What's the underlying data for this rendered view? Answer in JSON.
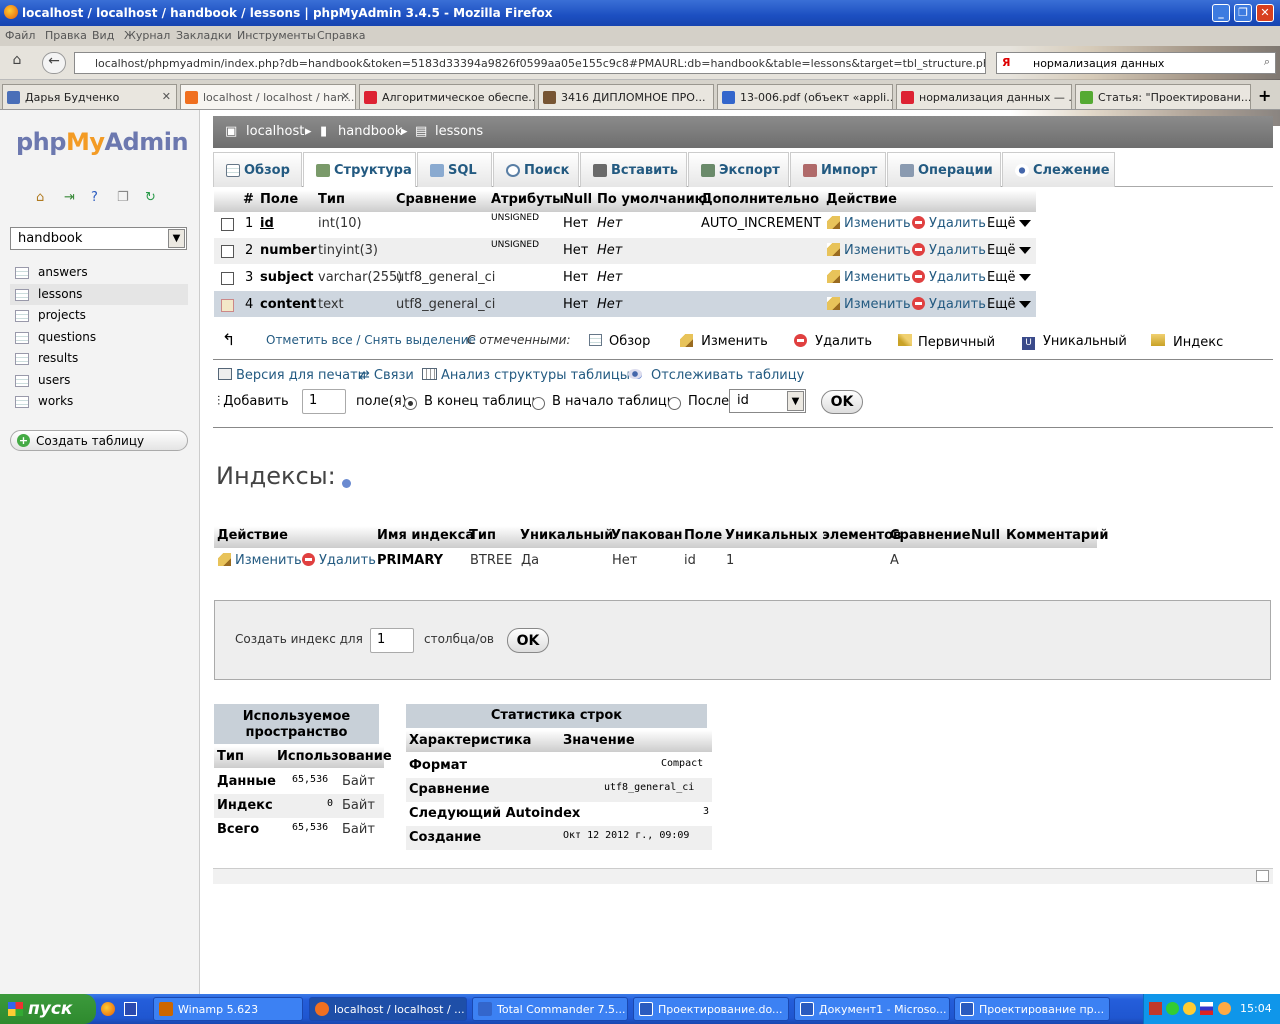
{
  "window": {
    "title": "localhost / localhost / handbook / lessons | phpMyAdmin 3.4.5 - Mozilla Firefox"
  },
  "menubar": [
    "Файл",
    "Правка",
    "Вид",
    "Журнал",
    "Закладки",
    "Инструменты",
    "Справка"
  ],
  "navbar": {
    "url": "localhost/phpmyadmin/index.php?db=handbook&token=5183d33394a9826f0599aa05e155c9c8#PMAURL:db=handbook&table=lessons&target=tbl_structure.php&token=5183",
    "search": "нормализация данных"
  },
  "browser_tabs": [
    {
      "label": "Дарья Будченко",
      "color": "#4a6fb8"
    },
    {
      "label": "localhost / localhost / han...",
      "color": "#f07020",
      "active": true
    },
    {
      "label": "Алгоритмическое обеспе...",
      "color": "#d23"
    },
    {
      "label": "3416 ДИПЛОМНОЕ ПРО...",
      "color": "#753"
    },
    {
      "label": "13-006.pdf (объект «appli...",
      "color": "#36c"
    },
    {
      "label": "нормализация данных — ...",
      "color": "#d23"
    },
    {
      "label": "Статья: \"Проектировани...",
      "color": "#5a3"
    }
  ],
  "sidebar": {
    "logo": {
      "php": "php",
      "my": "My",
      "admin": "Admin"
    },
    "db": "handbook",
    "tables": [
      "answers",
      "lessons",
      "projects",
      "questions",
      "results",
      "users",
      "works"
    ],
    "selected": "lessons",
    "create_table": "Создать таблицу"
  },
  "breadcrumb": {
    "server": "localhost",
    "db": "handbook",
    "table": "lessons"
  },
  "tabs": [
    "Обзор",
    "Структура",
    "SQL",
    "Поиск",
    "Вставить",
    "Экспорт",
    "Импорт",
    "Операции",
    "Слежение"
  ],
  "structure": {
    "headers": [
      "#",
      "Поле",
      "Тип",
      "Сравнение",
      "Атрибуты",
      "Null",
      "По умолчанию",
      "Дополнительно",
      "Действие"
    ],
    "rows": [
      {
        "n": "1",
        "name": "id",
        "type": "int(10)",
        "collation": "",
        "attr": "UNSIGNED",
        "null": "Нет",
        "default": "Нет",
        "extra": "AUTO_INCREMENT"
      },
      {
        "n": "2",
        "name": "number",
        "type": "tinyint(3)",
        "collation": "",
        "attr": "UNSIGNED",
        "null": "Нет",
        "default": "Нет",
        "extra": ""
      },
      {
        "n": "3",
        "name": "subject",
        "type": "varchar(255)",
        "collation": "utf8_general_ci",
        "attr": "",
        "null": "Нет",
        "default": "Нет",
        "extra": ""
      },
      {
        "n": "4",
        "name": "content",
        "type": "text",
        "collation": "utf8_general_ci",
        "attr": "",
        "null": "Нет",
        "default": "Нет",
        "extra": ""
      }
    ],
    "action_edit": "Изменить",
    "action_delete": "Удалить",
    "action_more": "Ещё"
  },
  "bulk": {
    "check_all": "Отметить все / Снять выделение",
    "with_selected": "С отмеченными:",
    "actions": [
      "Обзор",
      "Изменить",
      "Удалить",
      "Первичный",
      "Уникальный",
      "Индекс"
    ]
  },
  "tools": {
    "print": "Версия для печати",
    "relations": "Связи",
    "analyze": "Анализ структуры таблицы",
    "track": "Отслеживать таблицу",
    "add": "Добавить",
    "add_value": "1",
    "fields_word": "поле(я)",
    "at_end": "В конец таблицы",
    "at_start": "В начало таблицы",
    "after": "После",
    "after_field": "id",
    "ok": "OK"
  },
  "indexes": {
    "title": "Индексы:",
    "headers": [
      "Действие",
      "Имя индекса",
      "Тип",
      "Уникальный",
      "Упакован",
      "Поле",
      "Уникальных элементов",
      "Сравнение",
      "Null",
      "Комментарий"
    ],
    "row": {
      "edit": "Изменить",
      "delete": "Удалить",
      "name": "PRIMARY",
      "type": "BTREE",
      "unique": "Да",
      "packed": "Нет",
      "field": "id",
      "cardinality": "1",
      "collation": "A"
    },
    "create_label": "Создать индекс для",
    "create_value": "1",
    "create_suffix": "столбца/ов",
    "ok": "OK"
  },
  "space": {
    "title": "Используемое пространство",
    "headers": [
      "Тип",
      "Использование"
    ],
    "rows": [
      {
        "type": "Данные",
        "value": "65,536",
        "unit": "Байт"
      },
      {
        "type": "Индекс",
        "value": "0",
        "unit": "Байт"
      },
      {
        "type": "Всего",
        "value": "65,536",
        "unit": "Байт"
      }
    ]
  },
  "rowstats": {
    "title": "Статистика строк",
    "headers": [
      "Характеристика",
      "Значение"
    ],
    "rows": [
      {
        "k": "Формат",
        "v": "Compact"
      },
      {
        "k": "Сравнение",
        "v": "utf8_general_ci"
      },
      {
        "k": "Следующий Autoindex",
        "v": "3"
      },
      {
        "k": "Создание",
        "v": "Окт 12 2012 г., 09:09"
      }
    ]
  },
  "taskbar": {
    "start": "пуск",
    "items": [
      {
        "label": "Winamp 5.623",
        "color": "#c60"
      },
      {
        "label": "localhost / localhost / ...",
        "color": "#f07020",
        "active": true
      },
      {
        "label": "Total Commander 7.5...",
        "color": "#36c"
      },
      {
        "label": "Проектирование.do...",
        "color": "#2a5bbf"
      },
      {
        "label": "Документ1 - Microso...",
        "color": "#2a5bbf"
      },
      {
        "label": "Проектирование пр...",
        "color": "#2a5bbf"
      }
    ],
    "clock": "15:04"
  }
}
